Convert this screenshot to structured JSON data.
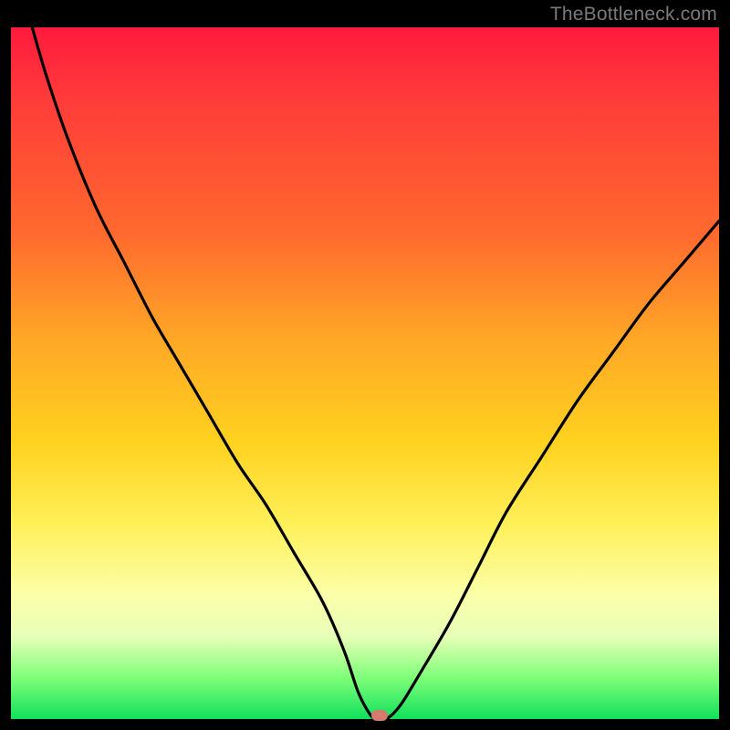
{
  "watermark": {
    "text": "TheBottleneck.com"
  },
  "colors": {
    "gradient_top": "#ff1a3c",
    "gradient_mid1": "#ff6a2e",
    "gradient_mid2": "#ffd21f",
    "gradient_mid3": "#fbffa8",
    "gradient_bottom": "#11e05a",
    "curve": "#000000",
    "marker": "#d77a6f",
    "frame": "#000000"
  },
  "chart_data": {
    "type": "line",
    "title": "",
    "xlabel": "",
    "ylabel": "",
    "xlim": [
      0,
      100
    ],
    "ylim": [
      0,
      100
    ],
    "grid": false,
    "legend": false,
    "series": [
      {
        "name": "bottleneck-curve",
        "x": [
          3,
          5,
          8,
          12,
          16,
          20,
          24,
          28,
          32,
          36,
          40,
          44,
          47,
          49,
          50.5,
          51.5,
          53,
          55,
          58,
          62,
          66,
          70,
          75,
          80,
          85,
          90,
          95,
          100
        ],
        "y": [
          100,
          93,
          84,
          74,
          66,
          58,
          51,
          44,
          37,
          31,
          24,
          17,
          10,
          4,
          1,
          0,
          0,
          2,
          7,
          14,
          22,
          30,
          38,
          46,
          53,
          60,
          66,
          72
        ]
      }
    ],
    "annotations": [
      {
        "name": "optimal-marker",
        "x": 52,
        "y": 0.5
      }
    ]
  }
}
